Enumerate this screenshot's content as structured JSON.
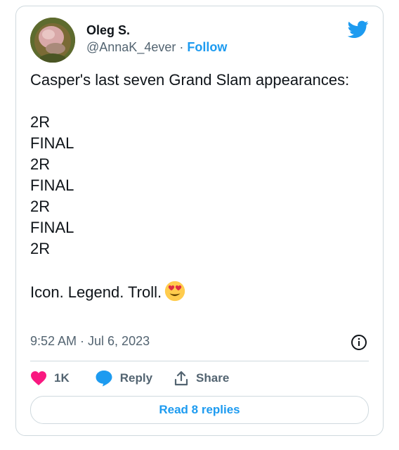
{
  "author": {
    "name": "Oleg S.",
    "handle": "@AnnaK_4ever",
    "separator": " · ",
    "follow_label": "Follow"
  },
  "tweet": {
    "text": "Casper's last seven Grand Slam appearances:\n\n2R\nFINAL\n2R\nFINAL\n2R\nFINAL\n2R\n\nIcon. Legend. Troll.",
    "emoji": "smiling-face-with-heart-eyes",
    "timestamp": "9:52 AM · Jul 6, 2023"
  },
  "actions": {
    "like_count": "1K",
    "reply_label": "Reply",
    "share_label": "Share"
  },
  "read_replies_label": "Read 8 replies",
  "colors": {
    "accent": "#1d9bf0",
    "like": "#f91880",
    "border": "#cfd9de",
    "muted": "#536471",
    "text": "#0f1419"
  }
}
